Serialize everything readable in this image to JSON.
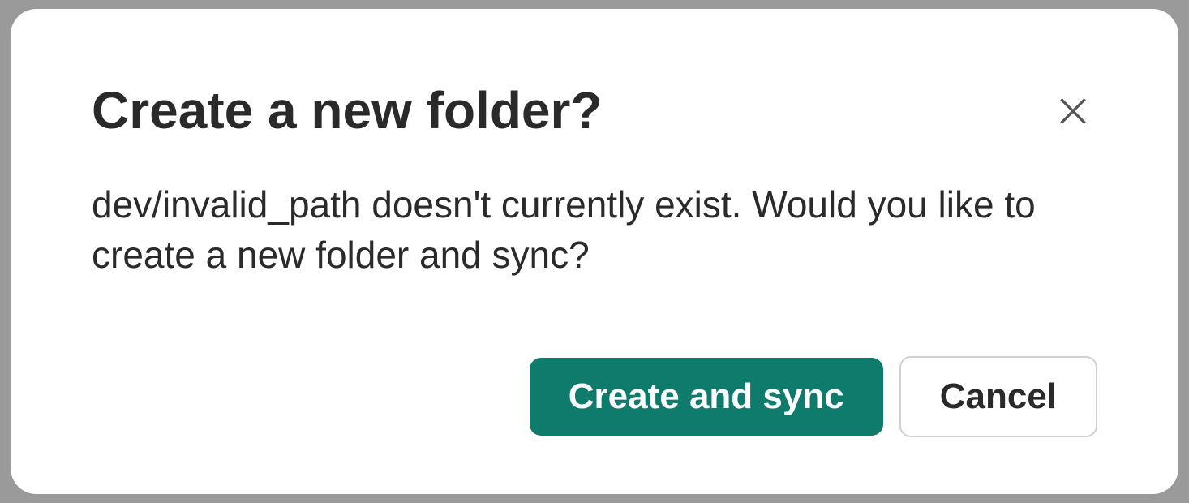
{
  "dialog": {
    "title": "Create a new folder?",
    "message": "dev/invalid_path doesn't currently exist. Would you like to create a new folder and sync?",
    "primary_label": "Create and sync",
    "secondary_label": "Cancel"
  }
}
